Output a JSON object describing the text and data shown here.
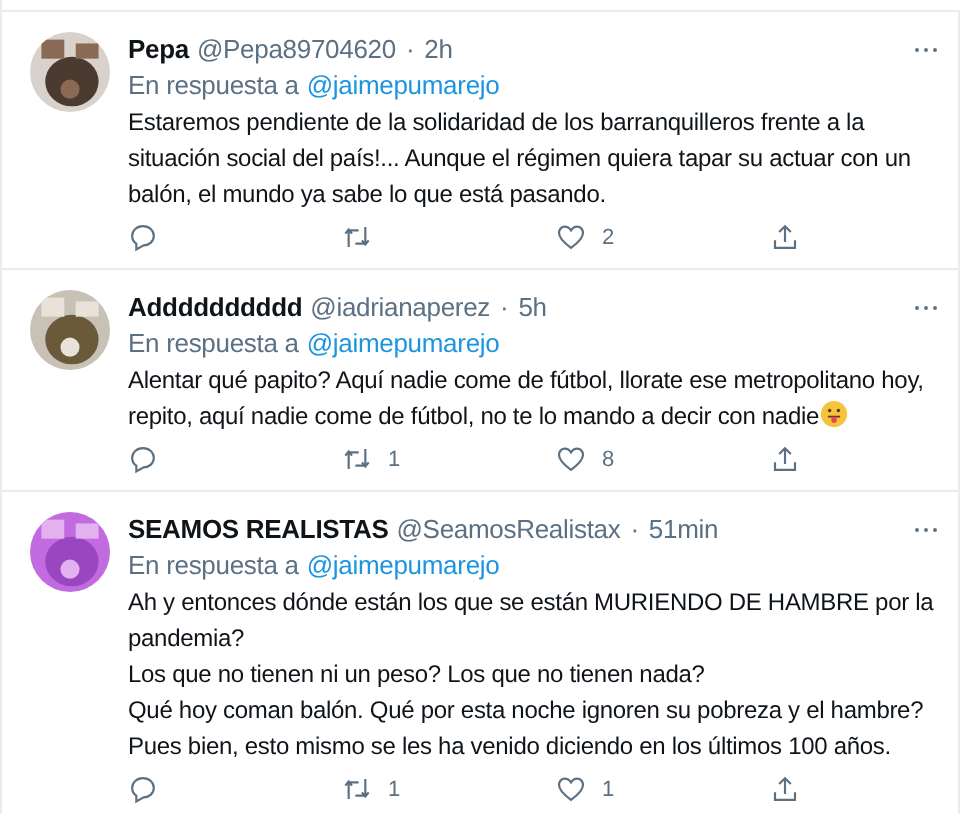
{
  "tweets": [
    {
      "name": "Pepa",
      "handle": "@Pepa89704620",
      "separator": "·",
      "time": "2h",
      "reply_label": "En respuesta a",
      "reply_to": "@jaimepumarejo",
      "body": "Estaremos pendiente de la solidaridad de los barranquilleros frente a la situación social del país!... Aunque el régimen quiera tapar su actuar con un balón, el mundo ya sabe lo que está pasando.",
      "likes": "2"
    },
    {
      "name": "Adddddddddd",
      "handle": "@iadrianaperez",
      "separator": "·",
      "time": "5h",
      "reply_label": "En respuesta a",
      "reply_to": "@jaimepumarejo",
      "body": "Alentar qué papito? Aquí nadie come de fútbol, llorate ese metropolitano hoy, repito, aquí nadie come de fútbol, no te lo mando a decir con nadie",
      "emoji_after": true,
      "retweets": "1",
      "likes": "8"
    },
    {
      "name": "SEAMOS REALISTAS",
      "handle": "@SeamosRealistax",
      "separator": "·",
      "time": "51min",
      "reply_label": "En respuesta a",
      "reply_to": "@jaimepumarejo",
      "body": "Ah y entonces dónde están los que se están MURIENDO DE HAMBRE por la pandemia?\nLos que no tienen ni un peso? Los que no tienen nada?\nQué hoy coman balón. Qué por esta noche ignoren su pobreza y el hambre?\nPues bien, esto mismo se les ha venido diciendo en los últimos 100 años.",
      "retweets": "1",
      "likes": "1"
    }
  ]
}
